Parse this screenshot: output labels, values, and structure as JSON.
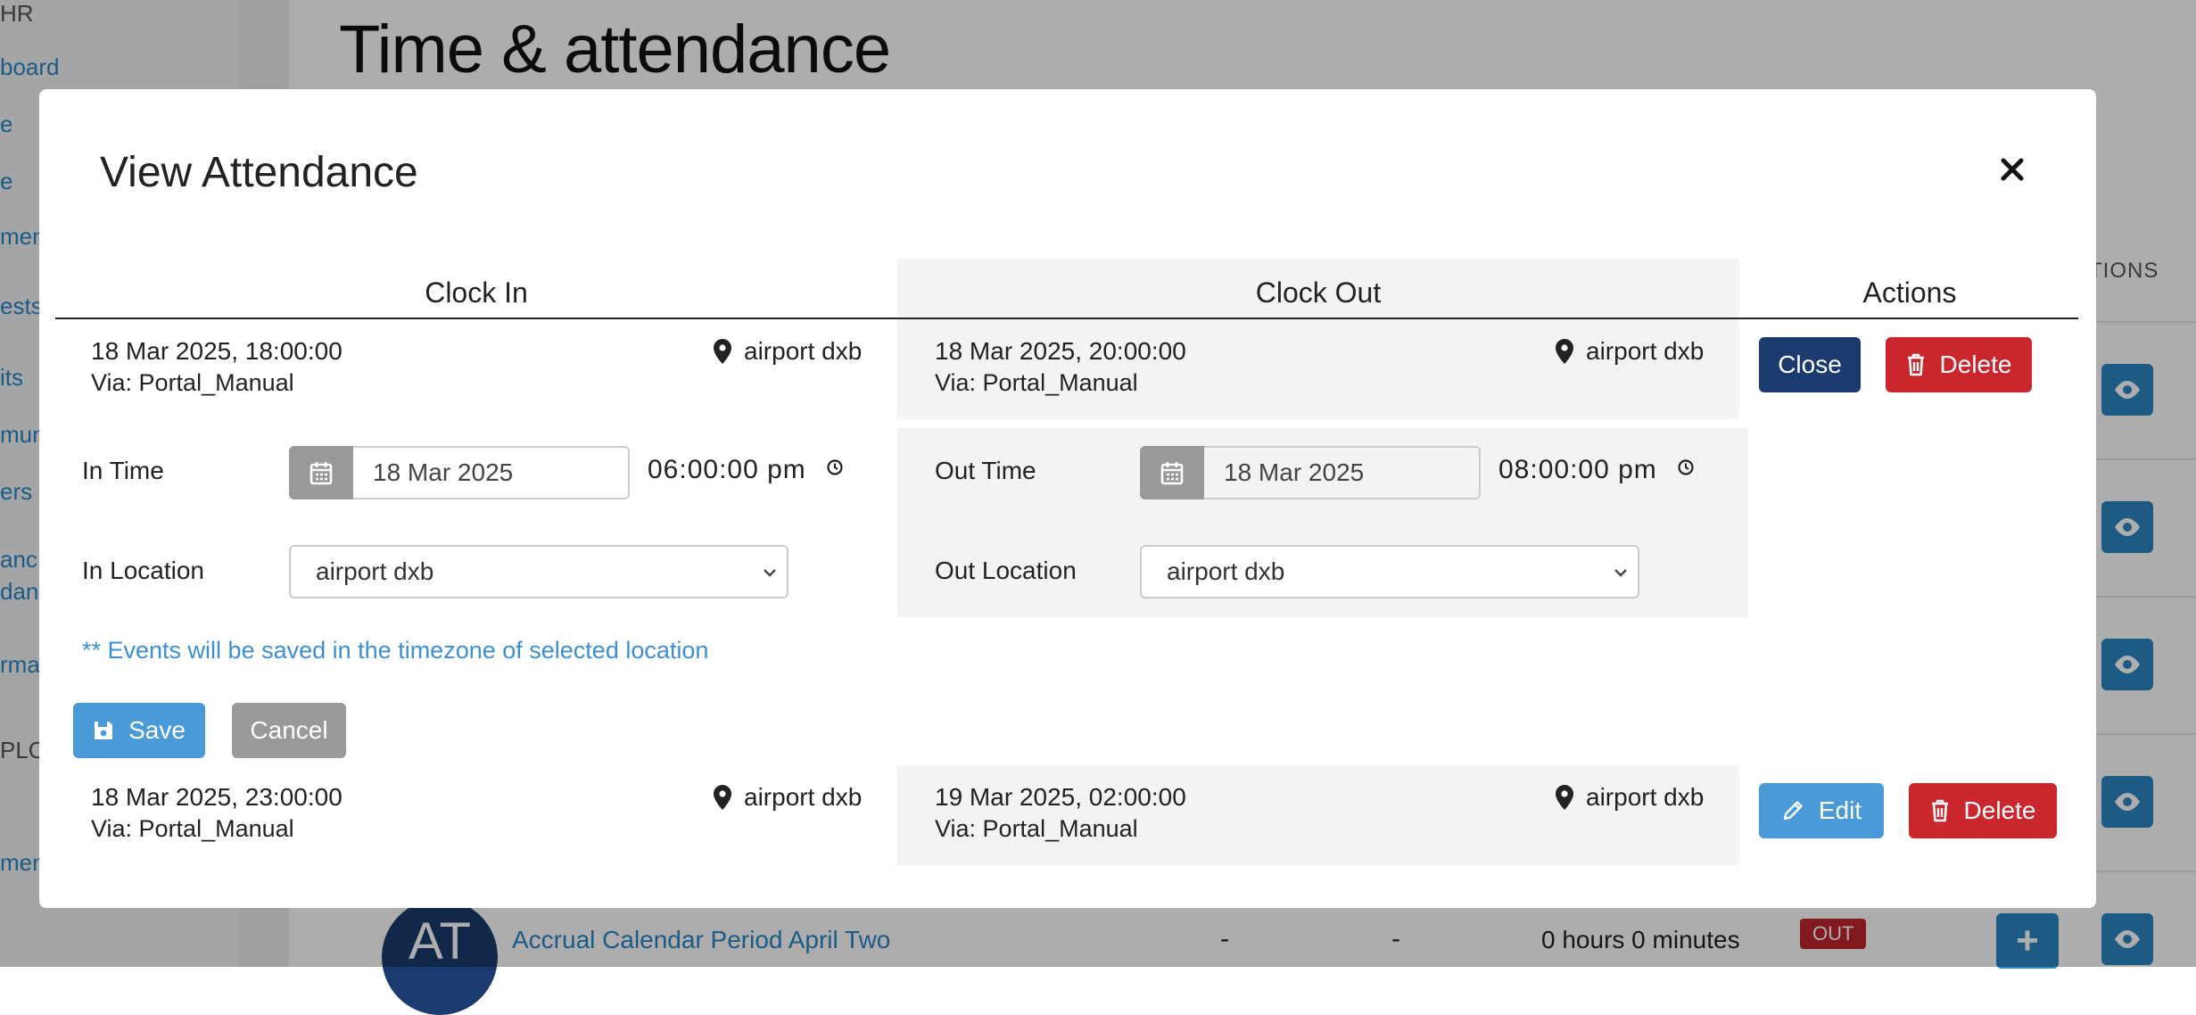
{
  "sidebar": {
    "heading": "HR",
    "items": [
      "board",
      "e",
      "e",
      "men",
      "ests",
      "its",
      "muni",
      "ers",
      "anc",
      "dan",
      "rma"
    ],
    "section": "PLO",
    "last": "men"
  },
  "page": {
    "title": "Time & attendance",
    "actions_col": "TIONS",
    "row": {
      "avatar": "AT",
      "name": "Accrual Calendar Period April Two",
      "dash1": "-",
      "dash2": "-",
      "hours": "0 hours 0 minutes",
      "status": "OUT",
      "plus": "+"
    }
  },
  "modal": {
    "title": "View Attendance",
    "headers": {
      "clock_in": "Clock In",
      "clock_out": "Clock Out",
      "actions": "Actions"
    },
    "record1": {
      "in_datetime": "18 Mar 2025, 18:00:00",
      "in_via": "Via: Portal_Manual",
      "in_location": "airport dxb",
      "out_datetime": "18 Mar 2025, 20:00:00",
      "out_via": "Via: Portal_Manual",
      "out_location": "airport dxb",
      "close_label": "Close",
      "delete_label": "Delete"
    },
    "edit_form": {
      "in_time_label": "In Time",
      "in_date": "18 Mar 2025",
      "in_time": "06:00:00 pm",
      "out_time_label": "Out Time",
      "out_date": "18 Mar 2025",
      "out_time": "08:00:00 pm",
      "in_location_label": "In Location",
      "in_location_value": "airport dxb",
      "out_location_label": "Out Location",
      "out_location_value": "airport dxb",
      "note": "** Events will be saved in the timezone of selected location",
      "save_label": "Save",
      "cancel_label": "Cancel"
    },
    "record2": {
      "in_datetime": "18 Mar 2025, 23:00:00",
      "in_via": "Via: Portal_Manual",
      "in_location": "airport dxb",
      "out_datetime": "19 Mar 2025, 02:00:00",
      "out_via": "Via: Portal_Manual",
      "out_location": "airport dxb",
      "edit_label": "Edit",
      "delete_label": "Delete"
    }
  },
  "colors": {
    "navy": "#1b3b6f",
    "red": "#c9262e",
    "blue": "#4a9ad8",
    "grey": "#999999",
    "link": "#2b86c5"
  }
}
